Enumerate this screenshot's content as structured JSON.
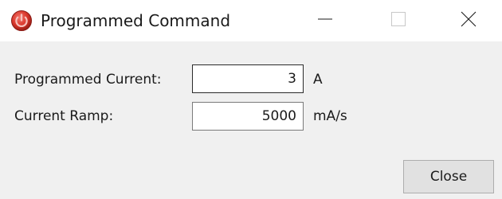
{
  "window": {
    "title": "Programmed Command",
    "app_icon": "power-button-icon",
    "controls": {
      "minimize_icon": "minimize-icon",
      "maximize_icon": "maximize-icon",
      "close_icon": "close-icon"
    }
  },
  "form": {
    "programmed_current": {
      "label": "Programmed Current:",
      "value": "3",
      "unit": "A",
      "focused": true
    },
    "current_ramp": {
      "label": "Current Ramp:",
      "value": "5000",
      "unit": "mA/s"
    }
  },
  "footer": {
    "close_label": "Close"
  },
  "colors": {
    "app_icon": "#d9362b",
    "window_bg": "#f0f0f0",
    "titlebar_bg": "#ffffff",
    "button_bg": "#e1e1e1"
  }
}
